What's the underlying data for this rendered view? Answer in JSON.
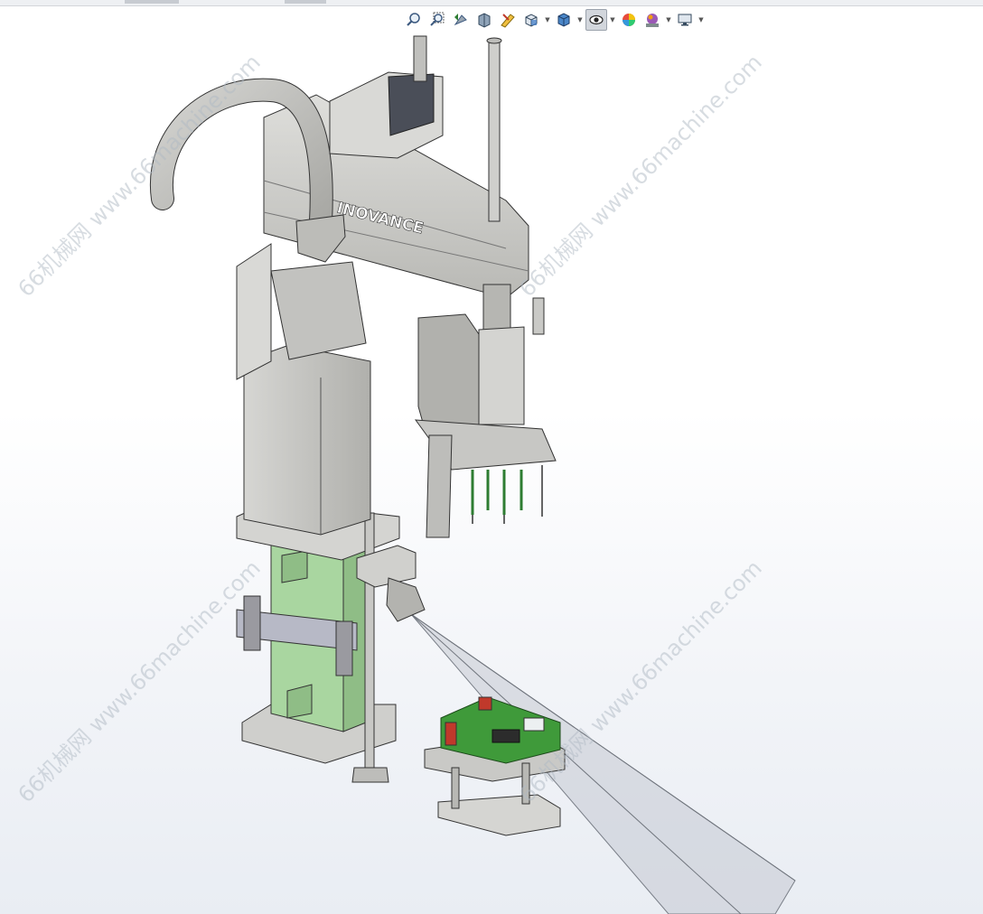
{
  "toolbar": {
    "buttons": [
      {
        "icon": "zoom-to-fit-icon",
        "dropdown": false
      },
      {
        "icon": "zoom-to-area-icon",
        "dropdown": false
      },
      {
        "icon": "previous-view-icon",
        "dropdown": false
      },
      {
        "icon": "section-view-icon",
        "dropdown": false
      },
      {
        "icon": "dynamic-annotation-icon",
        "dropdown": false
      },
      {
        "icon": "view-orientation-icon",
        "dropdown": true
      },
      {
        "icon": "display-style-icon",
        "dropdown": true
      },
      {
        "icon": "hide-show-items-icon",
        "dropdown": true,
        "active": true
      },
      {
        "icon": "edit-appearance-icon",
        "dropdown": false
      },
      {
        "icon": "apply-scene-icon",
        "dropdown": true
      },
      {
        "icon": "view-settings-icon",
        "dropdown": true
      }
    ]
  },
  "model": {
    "brand_label": "INOVANCE"
  },
  "watermark": {
    "text": "66机械网 www.66machine.com"
  },
  "colors": {
    "robot_gray": "#c9c9c6",
    "column_green": "#a9d6a0",
    "pcb_green": "#3f9a3a",
    "camera_cone": "#bfc4cc"
  }
}
